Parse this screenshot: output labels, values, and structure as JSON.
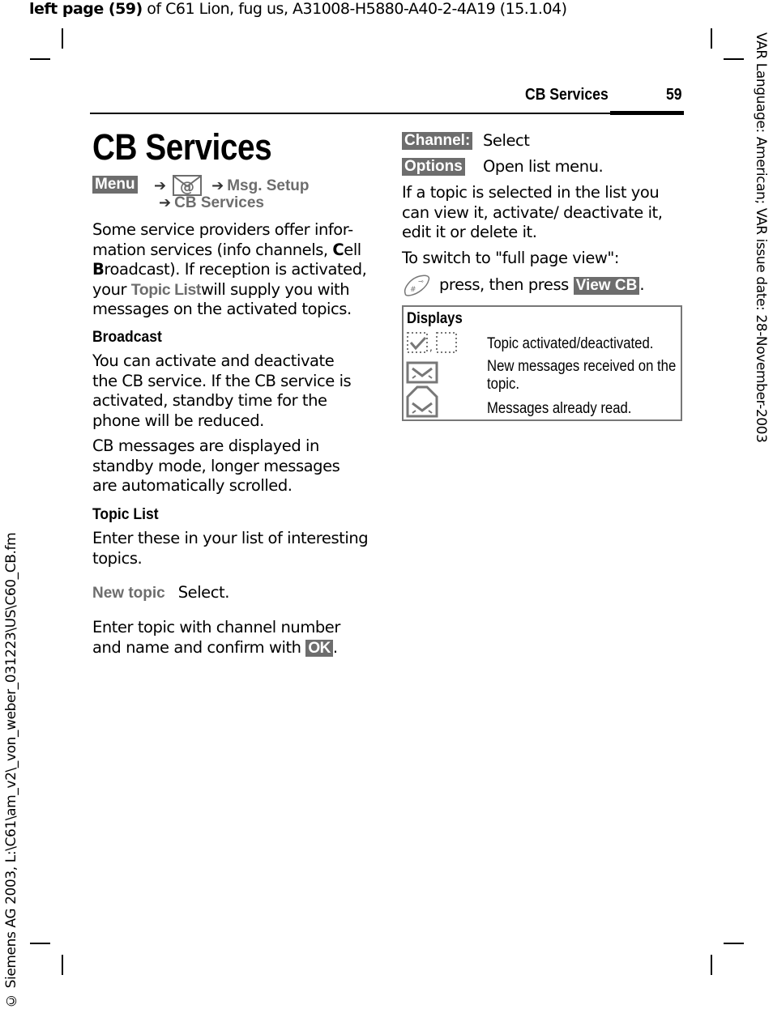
{
  "top_line": {
    "bold": "left page (59)",
    "rest": " of C61 Lion, fug us, A31008-H5880-A40-2-4A19 (15.1.04)"
  },
  "side_right": "VAR Language: American; VAR issue date: 28-November-2003",
  "side_left": "© Siemens AG 2003, L:\\C61\\am_v2\\_von_weber_031223\\US\\C60_CB.fm",
  "header": {
    "section": "CB Services",
    "page_number": "59"
  },
  "title": "CB Services",
  "menu_path": {
    "menu_key": "Menu",
    "arrow": "➔",
    "messages_icon": "envelope-at-icon",
    "step1": "Msg. Setup",
    "step2": "CB Services"
  },
  "intro": {
    "part1": "Some service providers offer infor-mation services (info channels, ",
    "c": "C",
    "part2": "ell ",
    "b": "B",
    "part3": "roadcast). If reception is activated, your ",
    "link": "Topic List",
    "part4": "will supply you with messages on the activated topics."
  },
  "broadcast": {
    "heading": "Broadcast",
    "p1": "You can activate and deactivate the CB service. If the CB service is activated, standby time for the phone will be reduced.",
    "p2": "CB messages are displayed in standby mode, longer messages are automatically scrolled."
  },
  "topic_list": {
    "heading": "Topic List",
    "p1": "Enter these in your list of interesting topics.",
    "new_topic_label": "New topic",
    "new_topic_action": "Select.",
    "p2_before": "Enter topic with channel number and name and confirm with ",
    "ok_key": "OK",
    "p2_after": "."
  },
  "right_col": {
    "channel_key": "Channel:",
    "channel_action": "Select",
    "options_key": "Options",
    "options_action": "Open list menu.",
    "p1": "If a topic is selected in the list you can view it, activate/ deactivate it, edit it or delete it.",
    "p2": "To switch to \"full page view\":",
    "press_text": "press, then press ",
    "viewcb_key": "View CB",
    "after": "."
  },
  "displays": {
    "heading": "Displays",
    "rows": [
      {
        "icon": "checkbox-icons",
        "text": "Topic activated/deactivated."
      },
      {
        "icon": "new-message-icon",
        "text": "New messages received on the topic."
      },
      {
        "icon": "read-message-icon",
        "text": "Messages already read."
      }
    ]
  }
}
